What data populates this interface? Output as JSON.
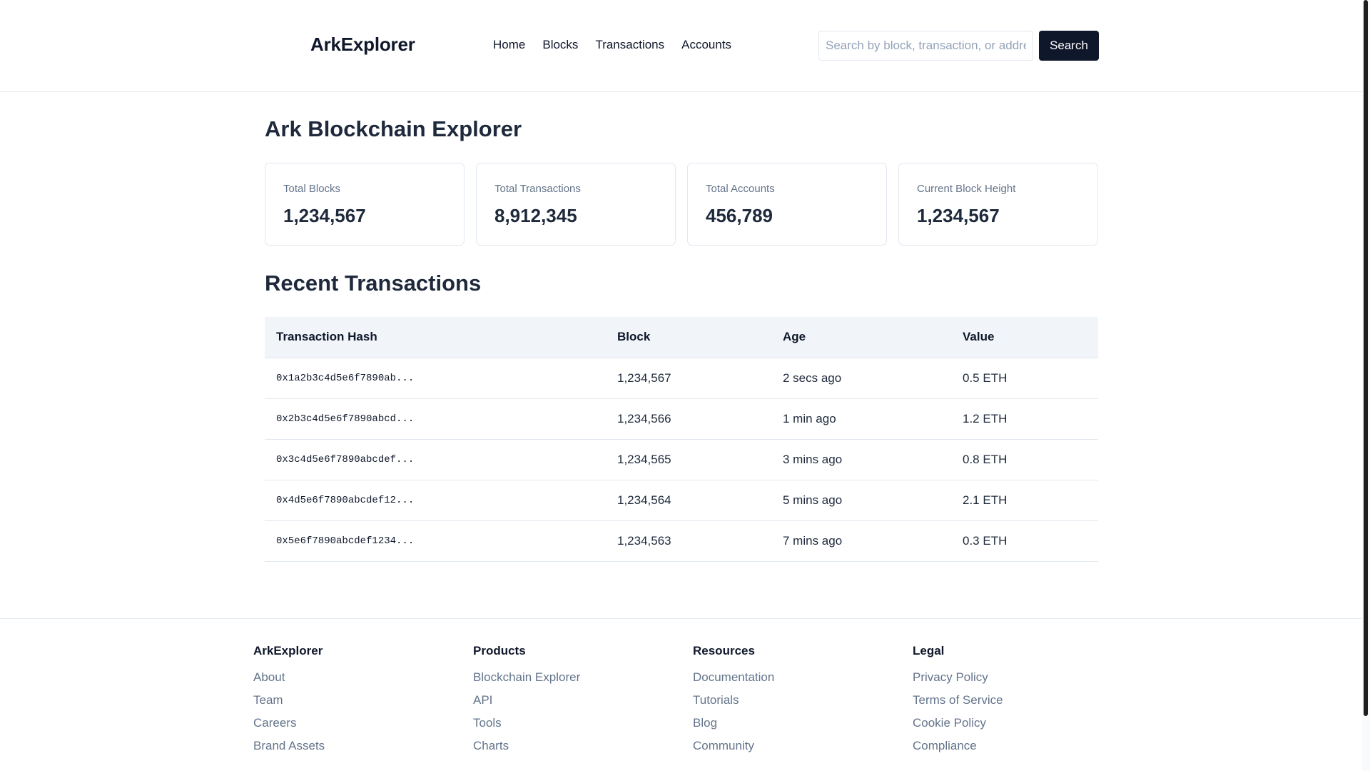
{
  "header": {
    "brand": "ArkExplorer",
    "nav": [
      "Home",
      "Blocks",
      "Transactions",
      "Accounts"
    ],
    "search": {
      "placeholder": "Search by block, transaction, or address",
      "value": "",
      "button_label": "Search"
    }
  },
  "main": {
    "title": "Ark Blockchain Explorer",
    "stats": [
      {
        "label": "Total Blocks",
        "value": "1,234,567"
      },
      {
        "label": "Total Transactions",
        "value": "8,912,345"
      },
      {
        "label": "Total Accounts",
        "value": "456,789"
      },
      {
        "label": "Current Block Height",
        "value": "1,234,567"
      }
    ],
    "recent_title": "Recent Transactions",
    "table": {
      "headers": [
        "Transaction Hash",
        "Block",
        "Age",
        "Value"
      ],
      "rows": [
        [
          "0x1a2b3c4d5e6f7890ab...",
          "1,234,567",
          "2 secs ago",
          "0.5 ETH"
        ],
        [
          "0x2b3c4d5e6f7890abcd...",
          "1,234,566",
          "1 min ago",
          "1.2 ETH"
        ],
        [
          "0x3c4d5e6f7890abcdef...",
          "1,234,565",
          "3 mins ago",
          "0.8 ETH"
        ],
        [
          "0x4d5e6f7890abcdef12...",
          "1,234,564",
          "5 mins ago",
          "2.1 ETH"
        ],
        [
          "0x5e6f7890abcdef1234...",
          "1,234,563",
          "7 mins ago",
          "0.3 ETH"
        ]
      ]
    }
  },
  "footer": {
    "columns": [
      {
        "heading": "ArkExplorer",
        "links": [
          "About",
          "Team",
          "Careers",
          "Brand Assets"
        ]
      },
      {
        "heading": "Products",
        "links": [
          "Blockchain Explorer",
          "API",
          "Tools",
          "Charts"
        ]
      },
      {
        "heading": "Resources",
        "links": [
          "Documentation",
          "Tutorials",
          "Blog",
          "Community"
        ]
      },
      {
        "heading": "Legal",
        "links": [
          "Privacy Policy",
          "Terms of Service",
          "Cookie Policy",
          "Compliance"
        ]
      }
    ]
  },
  "colors": {
    "primary": "#0f172a",
    "muted_text": "#64748b",
    "border": "#e2e8f0",
    "table_header_bg": "#f1f5f9",
    "background": "#ffffff"
  }
}
